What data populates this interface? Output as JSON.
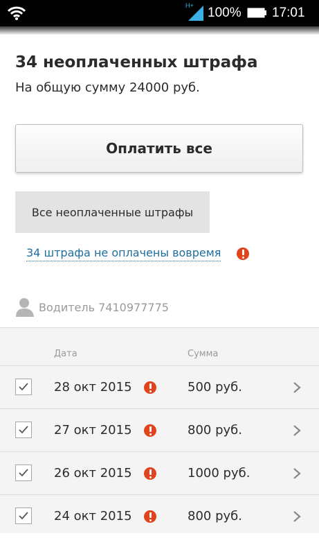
{
  "status_bar": {
    "network_type": "H+",
    "battery": "100%",
    "time": "17:01"
  },
  "header": {
    "title": "34 неоплаченных штрафа",
    "subtitle": "На общую сумму 24000 руб."
  },
  "actions": {
    "pay_all_label": "Оплатить все",
    "filter_label": "Все неоплаченные штрафы",
    "overdue_link": "34 штрафа не оплачены вовремя"
  },
  "driver": {
    "label": "Водитель 7410977775"
  },
  "table": {
    "columns": {
      "date": "Дата",
      "sum": "Сумма"
    },
    "rows": [
      {
        "date": "28 окт 2015",
        "sum": "500 руб.",
        "checked": true,
        "overdue": true
      },
      {
        "date": "27 окт 2015",
        "sum": "800 руб.",
        "checked": true,
        "overdue": true
      },
      {
        "date": "26 окт 2015",
        "sum": "1000 руб.",
        "checked": true,
        "overdue": true
      },
      {
        "date": "24 окт 2015",
        "sum": "800 руб.",
        "checked": true,
        "overdue": true
      }
    ]
  },
  "colors": {
    "alert": "#e0441d",
    "link": "#1e6fa0",
    "status_accent": "#3ab0e5"
  }
}
